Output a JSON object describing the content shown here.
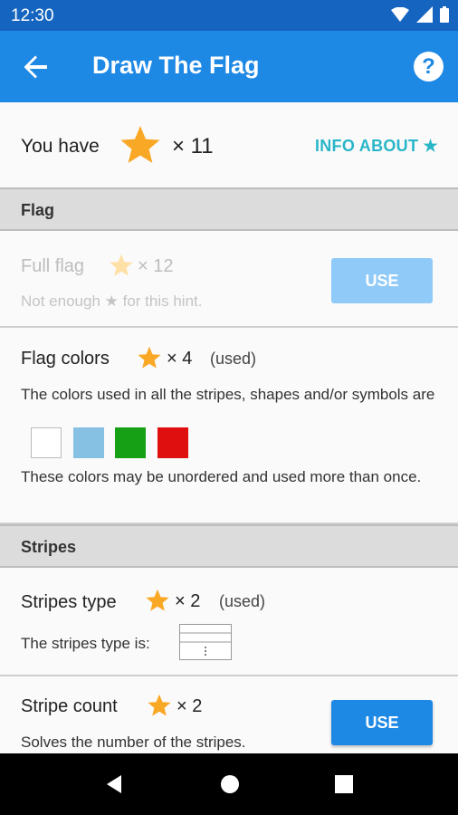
{
  "status": {
    "time": "12:30"
  },
  "appbar": {
    "title": "Draw The Flag"
  },
  "stars": {
    "label": "You have",
    "count": "× 11",
    "info_link": "INFO ABOUT ★"
  },
  "sections": {
    "flag": "Flag",
    "stripes": "Stripes"
  },
  "full_flag": {
    "title": "Full flag",
    "cost": "× 12",
    "note": "Not enough ★ for this hint.",
    "button": "USE"
  },
  "flag_colors": {
    "title": "Flag colors",
    "cost": "× 4",
    "status": "(used)",
    "description": "The colors used in all the stripes, shapes and/or symbols are",
    "colors": [
      "#ffffff",
      "#86c1e3",
      "#15a015",
      "#e00f0f"
    ],
    "note": "These colors may be unordered and used more than once."
  },
  "stripes_type": {
    "title": "Stripes type",
    "cost": "× 2",
    "status": "(used)",
    "description": "The stripes type is:"
  },
  "stripe_count": {
    "title": "Stripe count",
    "cost": "× 2",
    "description": "Solves the number of the stripes.",
    "button": "USE"
  }
}
